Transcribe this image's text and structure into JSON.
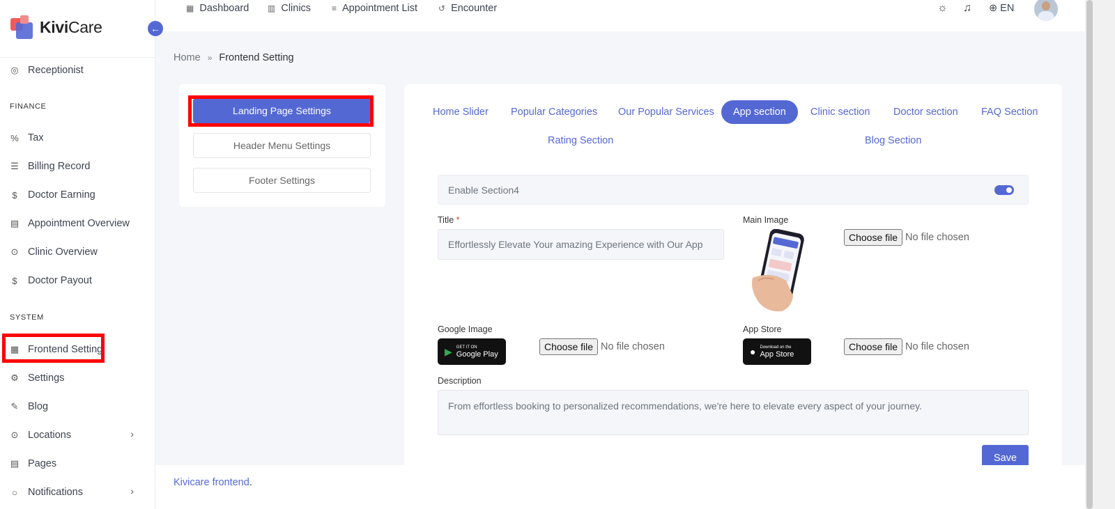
{
  "brand": {
    "name_bold": "Kivi",
    "name_rest": "Care"
  },
  "sidebar": {
    "items": [
      {
        "label": "Receptionist",
        "icon": "receptionist-icon"
      },
      {
        "label": "Tax",
        "icon": "percent-icon"
      },
      {
        "label": "Billing Record",
        "icon": "billing-icon"
      },
      {
        "label": "Doctor Earning",
        "icon": "dollar-icon"
      },
      {
        "label": "Appointment Overview",
        "icon": "document-icon"
      },
      {
        "label": "Clinic Overview",
        "icon": "location-pin-icon"
      },
      {
        "label": "Doctor Payout",
        "icon": "dollar-icon"
      },
      {
        "label": "Frontend Setting",
        "icon": "layout-icon"
      },
      {
        "label": "Settings",
        "icon": "gear-icon"
      },
      {
        "label": "Blog",
        "icon": "pencil-icon"
      },
      {
        "label": "Locations",
        "icon": "location-pin-icon"
      },
      {
        "label": "Pages",
        "icon": "page-icon"
      },
      {
        "label": "Notifications",
        "icon": "bell-icon"
      }
    ],
    "sections": {
      "finance": "FINANCE",
      "system": "SYSTEM"
    }
  },
  "topbar": {
    "links": [
      "Dashboard",
      "Clinics",
      "Appointment List",
      "Encounter"
    ],
    "lang": "EN"
  },
  "breadcrumb": {
    "home": "Home",
    "current": "Frontend Setting"
  },
  "settings_menu": [
    "Landing Page Settings",
    "Header Menu Settings",
    "Footer Settings"
  ],
  "tabs": [
    "Home Slider",
    "Popular Categories",
    "Our Popular Services",
    "App section",
    "Clinic section",
    "Doctor section",
    "FAQ Section",
    "Rating Section",
    "Blog Section"
  ],
  "form": {
    "enable_label": "Enable Section4",
    "title_label": "Title",
    "title_required": "*",
    "title_value": "Effortlessly Elevate Your amazing Experience with Our App",
    "main_image_label": "Main Image",
    "google_image_label": "Google Image",
    "app_store_label": "App Store",
    "choose_file": "Choose file",
    "no_file": "No file chosen",
    "google_badge_small": "GET IT ON",
    "google_badge_big": "Google Play",
    "apple_badge_small": "Download on the",
    "apple_badge_big": "App Store",
    "description_label": "Description",
    "description_value": "From effortless booking to personalized recommendations, we're here to elevate every aspect of your journey.",
    "save": "Save"
  },
  "footer": {
    "link": "Kivicare frontend",
    "suffix": "."
  },
  "colors": {
    "accent": "#5468d4",
    "highlight": "#ff0000"
  }
}
